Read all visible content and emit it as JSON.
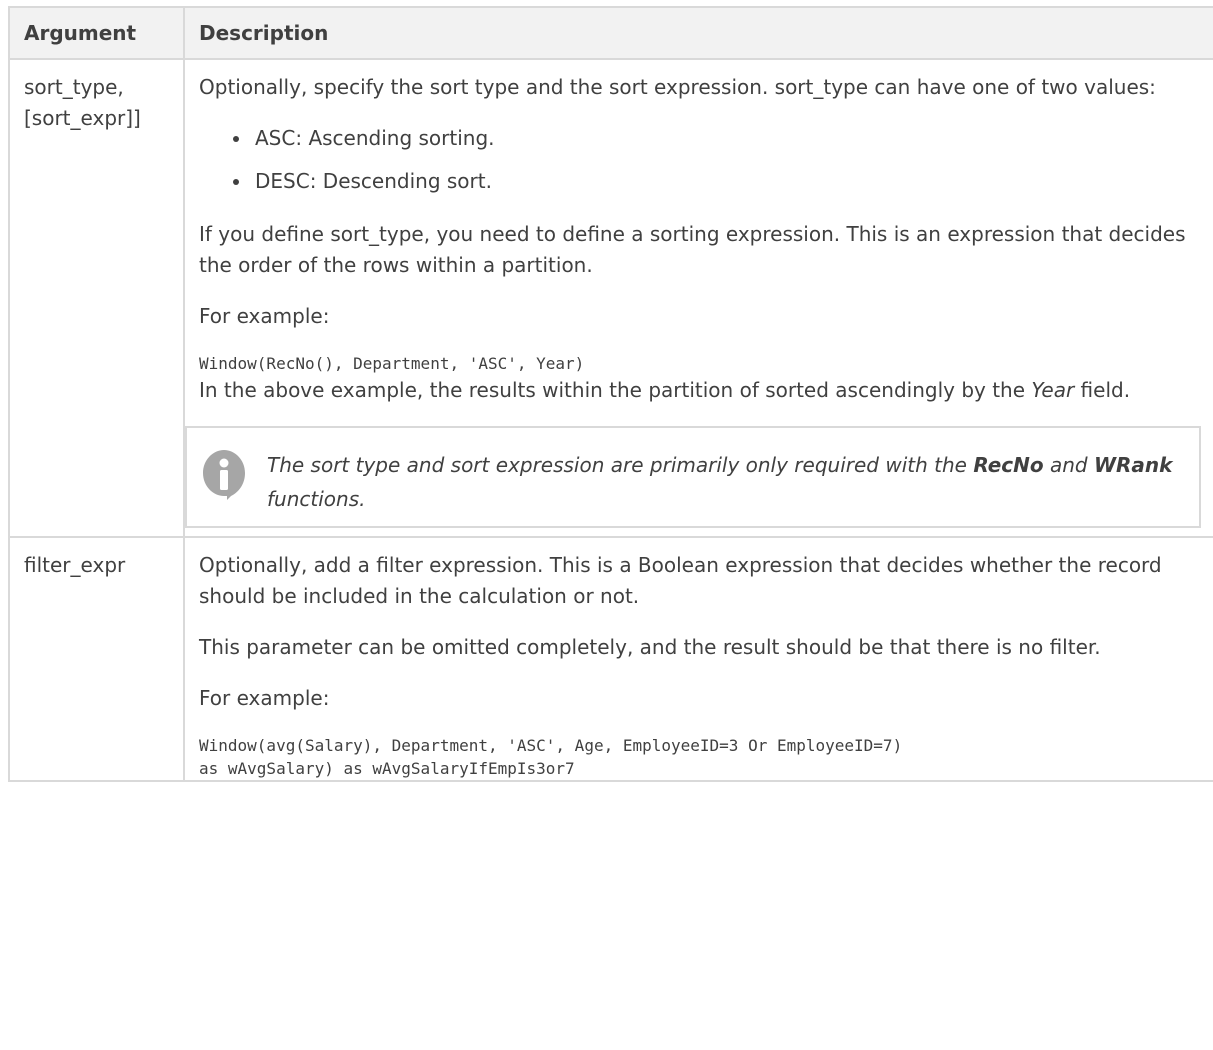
{
  "table": {
    "header": {
      "argument": "Argument",
      "description": "Description"
    },
    "rows": [
      {
        "argument": "sort_type, [sort_expr]]",
        "intro": "Optionally, specify the sort type and the sort expression. sort_type can have one of two values:",
        "values": [
          "ASC: Ascending sorting.",
          "DESC: Descending sort."
        ],
        "para_define": "If you define sort_type, you need to define a sorting expression. This is an expression that decides the order of the rows within a partition.",
        "example_label": "For example:",
        "code": "Window(RecNo(), Department, 'ASC', Year)",
        "after_code_prefix": "In the above example, the results within the partition of sorted ascendingly by the ",
        "after_code_field": "Year",
        "after_code_suffix": " field.",
        "note": {
          "icon": "info-icon",
          "text_prefix": "The sort type and sort expression are primarily only required with the ",
          "func1": "RecNo",
          "text_mid": " and ",
          "func2": "WRank",
          "text_suffix": " functions."
        }
      },
      {
        "argument": "filter_expr",
        "intro": "Optionally, add a filter expression. This is a Boolean expression that decides whether the record should be included in the calculation or not.",
        "para_omit": "This parameter can be omitted completely, and the result should be that there is no filter.",
        "example_label": "For example:",
        "code_line1": "Window(avg(Salary), Department, 'ASC', Age, EmployeeID=3 Or EmployeeID=7)",
        "code_line2": "as wAvgSalary) as wAvgSalaryIfEmpIs3or7"
      }
    ]
  }
}
